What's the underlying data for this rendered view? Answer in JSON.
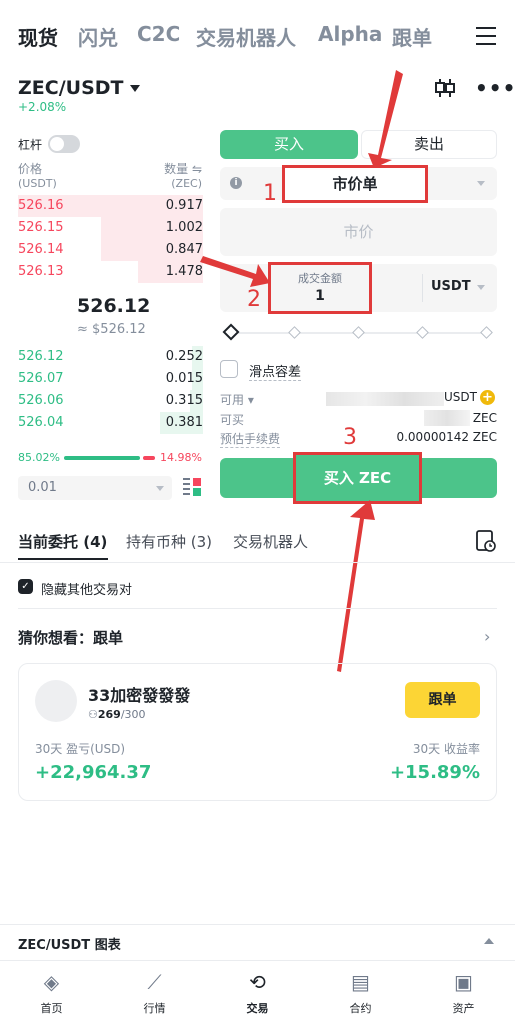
{
  "topnav": {
    "tabs": [
      "现货",
      "闪兑",
      "C2C",
      "交易机器人",
      "Alpha",
      "跟单"
    ]
  },
  "pair": {
    "name": "ZEC/USDT",
    "change": "+2.08%"
  },
  "leverage": {
    "label": "杠杆"
  },
  "orderbook": {
    "price_header": "价格",
    "price_unit": "(USDT)",
    "qty_header": "数量 ⇋",
    "qty_unit": "(ZEC)",
    "asks": [
      {
        "price": "526.16",
        "qty": "0.917",
        "depth": 1.0
      },
      {
        "price": "526.15",
        "qty": "1.002",
        "depth": 0.55
      },
      {
        "price": "526.14",
        "qty": "0.847",
        "depth": 0.55
      },
      {
        "price": "526.13",
        "qty": "1.478",
        "depth": 0.35
      }
    ],
    "mid_price": "526.12",
    "mid_fiat": "≈ $526.12",
    "bids": [
      {
        "price": "526.12",
        "qty": "0.252",
        "depth": 0.06
      },
      {
        "price": "526.07",
        "qty": "0.015",
        "depth": 0.06
      },
      {
        "price": "526.06",
        "qty": "0.315",
        "depth": 0.07
      },
      {
        "price": "526.04",
        "qty": "0.381",
        "depth": 0.23
      }
    ],
    "buy_pct": "85.02%",
    "sell_pct": "14.98%",
    "buy_ratio": 0.8502,
    "precision": "0.01"
  },
  "order": {
    "buy_tab": "买入",
    "sell_tab": "卖出",
    "order_type": "市价单",
    "price_placeholder": "市价",
    "amount_label": "成交金额",
    "amount_value": "1",
    "amount_unit": "USDT",
    "slippage_label": "滑点容差",
    "available_label": "可用 ▾",
    "available_unit": "USDT",
    "can_buy_label": "可买",
    "can_buy_unit": "ZEC",
    "fee_label": "预估手续费",
    "fee_value": "0.00000142 ZEC",
    "submit_label": "买入 ZEC"
  },
  "annotations": {
    "n1": "1",
    "n2": "2",
    "n3": "3"
  },
  "orders_tabs": {
    "current": "当前委托 (4)",
    "holdings": "持有币种 (3)",
    "bots": "交易机器人"
  },
  "hide_other_pairs": "隐藏其他交易对",
  "suggest": {
    "label": "猜你想看：跟单"
  },
  "trader_card": {
    "name": "33加密發發發",
    "followers": "269",
    "followers_cap": "/300",
    "follow_button": "跟单",
    "pnl_label": "30天 盈亏(USD)",
    "pnl_value": "+22,964.37",
    "roi_label": "30天 收益率",
    "roi_value": "+15.89%"
  },
  "chart_bar": {
    "label": "ZEC/USDT 图表"
  },
  "bottomnav": [
    {
      "label": "首页",
      "icon": "home-icon"
    },
    {
      "label": "行情",
      "icon": "market-icon"
    },
    {
      "label": "交易",
      "icon": "trade-icon"
    },
    {
      "label": "合约",
      "icon": "futures-icon"
    },
    {
      "label": "资产",
      "icon": "wallet-icon"
    }
  ],
  "colors": {
    "green": "#2ebd85",
    "red": "#f6465d",
    "annotation_red": "#e03a3a",
    "yellow": "#fcd535"
  }
}
